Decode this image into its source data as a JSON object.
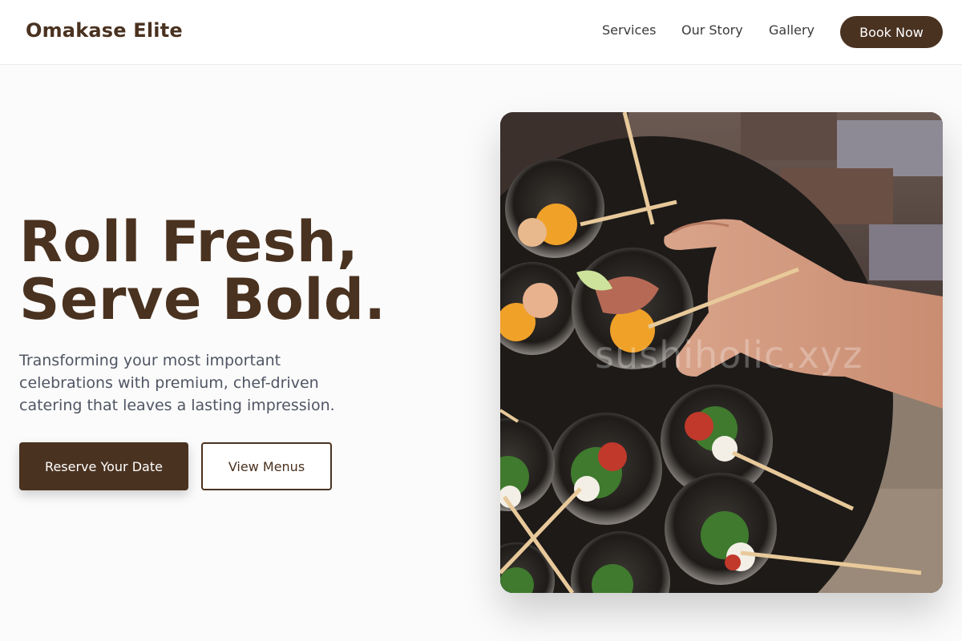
{
  "header": {
    "brand": "Omakase Elite",
    "nav": [
      "Services",
      "Our Story",
      "Gallery"
    ],
    "cta": "Book Now"
  },
  "hero": {
    "title_line1": "Roll Fresh,",
    "title_line2": "Serve Bold.",
    "subtitle": "Transforming your most important celebrations with premium, chef-driven catering that leaves a lasting impression.",
    "primary_button": "Reserve Your Date",
    "secondary_button": "View Menus",
    "image_watermark": "sushiholic.xyz",
    "image_alt": "Hand holding a glass of appetizer with skewered caprese cups on a dark tray"
  },
  "colors": {
    "brand": "#4a3220",
    "background": "#fbfbfb",
    "subtitle_text": "#4f5563"
  }
}
